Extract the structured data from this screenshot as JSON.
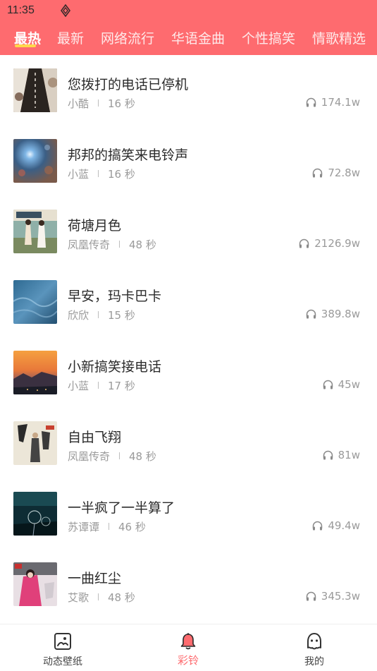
{
  "status_bar": {
    "time": "11:35"
  },
  "tabs": [
    {
      "label": "最热",
      "active": true
    },
    {
      "label": "最新"
    },
    {
      "label": "网络流行"
    },
    {
      "label": "华语金曲"
    },
    {
      "label": "个性搞笑"
    },
    {
      "label": "情歌精选"
    }
  ],
  "ringtones": [
    {
      "title": "您拨打的电话已停机",
      "artist": "小酷",
      "duration": "16 秒",
      "plays": "174.1w"
    },
    {
      "title": "邦邦的搞笑来电铃声",
      "artist": "小蓝",
      "duration": "16 秒",
      "plays": "72.8w"
    },
    {
      "title": "荷塘月色",
      "artist": "凤凰传奇",
      "duration": "48 秒",
      "plays": "2126.9w"
    },
    {
      "title": "早安，玛卡巴卡",
      "artist": "欣欣",
      "duration": "15 秒",
      "plays": "389.8w"
    },
    {
      "title": "小新搞笑接电话",
      "artist": "小蓝",
      "duration": "17 秒",
      "plays": "45w"
    },
    {
      "title": "自由飞翔",
      "artist": "凤凰传奇",
      "duration": "48 秒",
      "plays": "81w"
    },
    {
      "title": "一半疯了一半算了",
      "artist": "苏谭谭",
      "duration": "46 秒",
      "plays": "49.4w"
    },
    {
      "title": "一曲红尘",
      "artist": "艾歌",
      "duration": "48 秒",
      "plays": "345.3w"
    }
  ],
  "bottom_nav": [
    {
      "label": "动态壁纸",
      "icon": "wallpaper-icon"
    },
    {
      "label": "彩铃",
      "icon": "bell-icon",
      "active": true
    },
    {
      "label": "我的",
      "icon": "profile-icon"
    }
  ],
  "colors": {
    "header": "#fe6b6f",
    "indicator": "#ffd84a",
    "accent": "#fe6b6f"
  }
}
